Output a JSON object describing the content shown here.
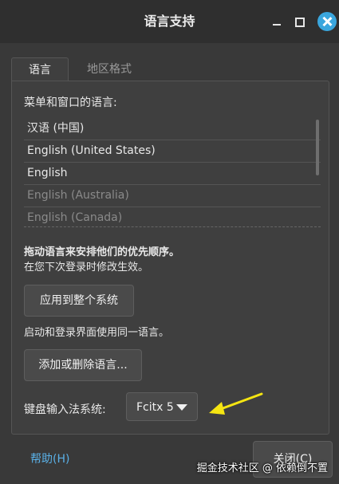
{
  "window": {
    "title": "语言支持"
  },
  "tabs": [
    {
      "label": "语言",
      "active": true
    },
    {
      "label": "地区格式",
      "active": false
    }
  ],
  "languages": {
    "heading": "菜单和窗口的语言:",
    "items": [
      {
        "label": "汉语 (中国)",
        "enabled": true
      },
      {
        "label": "English (United States)",
        "enabled": true
      },
      {
        "label": "English",
        "enabled": true
      },
      {
        "label": "English (Australia)",
        "enabled": false
      },
      {
        "label": "English (Canada)",
        "enabled": false
      }
    ],
    "hint_bold": "拖动语言来安排他们的优先顺序。",
    "hint_note": "在您下次登录时修改生效。"
  },
  "apply": {
    "button_label": "应用到整个系统",
    "note": "启动和登录界面使用同一语言。"
  },
  "install": {
    "button_label": "添加或删除语言..."
  },
  "input_method": {
    "label": "键盘输入法系统:",
    "selected": "Fcitx 5"
  },
  "footer": {
    "help_label": "帮助(H)",
    "close_label": "关闭(C)"
  },
  "watermark": "掘金技术社区 @ 依赖倒不置",
  "colors": {
    "accent": "#3aa6dd",
    "annotation_arrow": "#f5e512"
  }
}
